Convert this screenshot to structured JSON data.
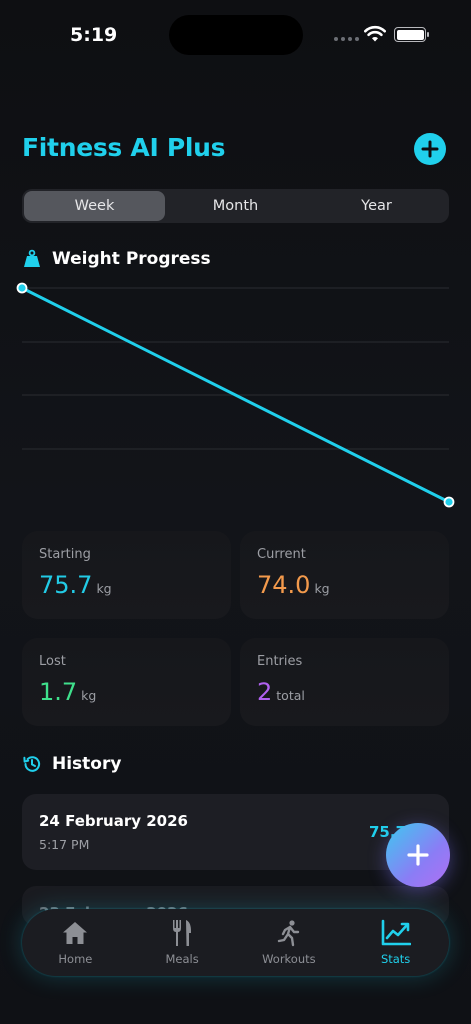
{
  "status_bar": {
    "time": "5:19"
  },
  "header": {
    "title": "Fitness AI Plus"
  },
  "period_tabs": [
    {
      "label": "Week",
      "active": true
    },
    {
      "label": "Month",
      "active": false
    },
    {
      "label": "Year",
      "active": false
    }
  ],
  "weight_section": {
    "title": "Weight Progress",
    "icon": "weight-icon"
  },
  "chart_data": {
    "type": "line",
    "title": "",
    "series": [
      {
        "values": [
          75.7,
          74.0
        ]
      }
    ],
    "grid": true,
    "color": "#20d0ec"
  },
  "stats": {
    "starting": {
      "label": "Starting",
      "value": "75.7",
      "unit": "kg",
      "color": "#22cbe6"
    },
    "current": {
      "label": "Current",
      "value": "74.0",
      "unit": "kg",
      "color": "#f39a4c"
    },
    "lost": {
      "label": "Lost",
      "value": "1.7",
      "unit": "kg",
      "color": "#3fe08c"
    },
    "entries": {
      "label": "Entries",
      "value": "2",
      "unit": "total",
      "color": "#b061f0"
    }
  },
  "history": {
    "title": "History",
    "items": [
      {
        "date": "24 February 2026",
        "time": "5:17 PM",
        "weight": "75.7"
      },
      {
        "date": "23 February 2026"
      }
    ]
  },
  "tab_bar": {
    "items": [
      {
        "label": "Home",
        "icon": "home-icon",
        "active": false
      },
      {
        "label": "Meals",
        "icon": "fork-knife-icon",
        "active": false
      },
      {
        "label": "Workouts",
        "icon": "running-icon",
        "active": false
      },
      {
        "label": "Stats",
        "icon": "chart-line-icon",
        "active": true
      }
    ]
  },
  "colors": {
    "accent": "#20d0ec",
    "fab_gradient": [
      "#3ec9f0",
      "#b070f4"
    ]
  }
}
